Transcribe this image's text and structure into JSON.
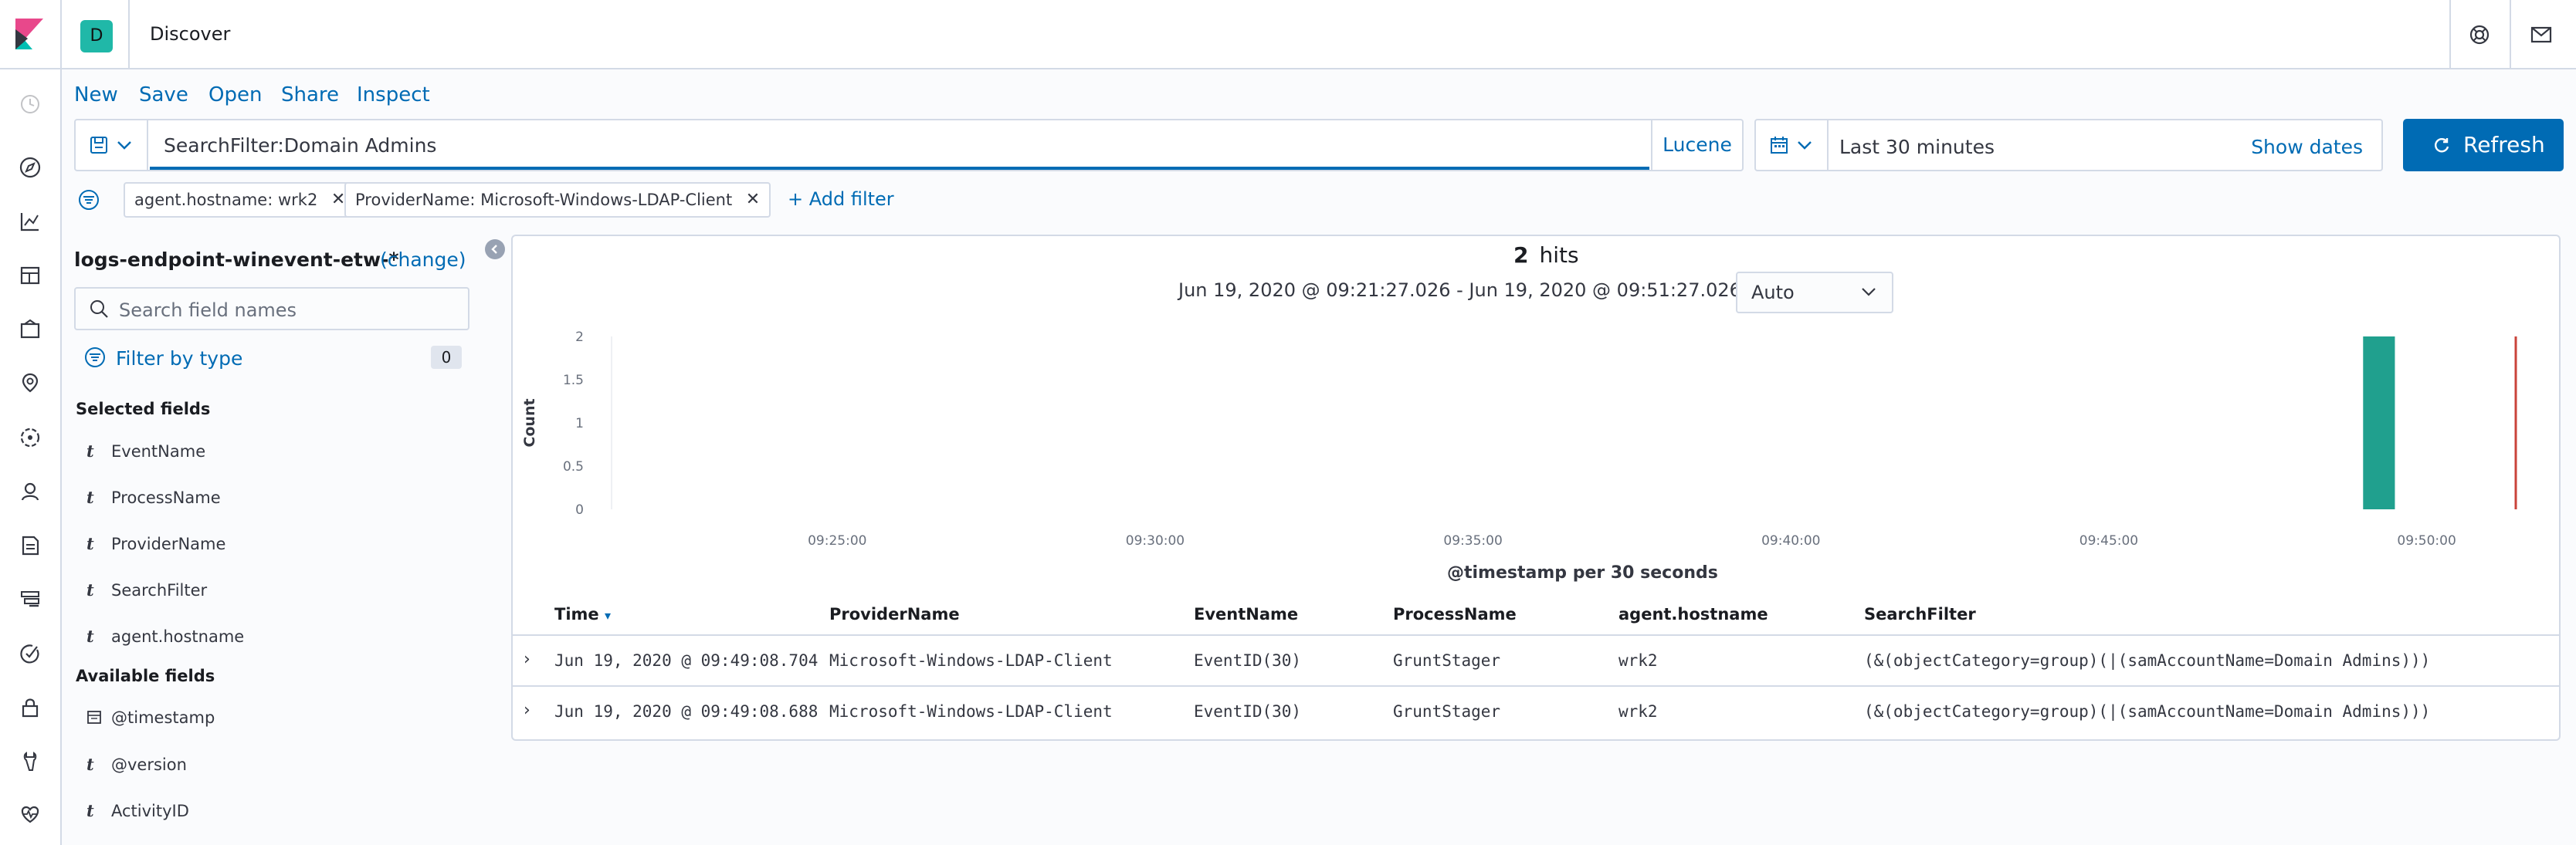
{
  "header": {
    "space_initial": "D",
    "app_title": "Discover"
  },
  "top_menu": [
    "New",
    "Save",
    "Open",
    "Share",
    "Inspect"
  ],
  "query": {
    "value": "SearchFilter:Domain Admins",
    "language": "Lucene"
  },
  "time": {
    "range_label": "Last 30 minutes",
    "show_dates": "Show dates",
    "refresh_label": "Refresh"
  },
  "filters": {
    "pills": [
      "agent.hostname: wrk2",
      "ProviderName: Microsoft-Windows-LDAP-Client"
    ],
    "add_label": "+ Add filter"
  },
  "sidebar": {
    "index_pattern": "logs-endpoint-winevent-etw-*",
    "change_label": "(change)",
    "search_placeholder": "Search field names",
    "filter_by_type": "Filter by type",
    "filter_count": "0",
    "selected_heading": "Selected fields",
    "selected_fields": [
      "EventName",
      "ProcessName",
      "ProviderName",
      "SearchFilter",
      "agent.hostname"
    ],
    "available_heading": "Available fields",
    "available_fields": [
      {
        "type": "date",
        "name": "@timestamp"
      },
      {
        "type": "t",
        "name": "@version"
      },
      {
        "type": "t",
        "name": "ActivityID"
      }
    ]
  },
  "results": {
    "hits_count": "2",
    "hits_label": "hits",
    "range_text": "Jun 19, 2020 @ 09:21:27.026 - Jun 19, 2020 @ 09:51:27.026 —",
    "interval": "Auto"
  },
  "chart_data": {
    "type": "bar",
    "xlabel": "@timestamp per 30 seconds",
    "ylabel": "Count",
    "ylim": [
      0,
      2
    ],
    "yticks": [
      "0",
      "0.5",
      "1",
      "1.5",
      "2"
    ],
    "xticks": [
      "09:25:00",
      "09:30:00",
      "09:35:00",
      "09:40:00",
      "09:45:00",
      "09:50:00"
    ],
    "x_range_minutes": [
      "09:21:27",
      "09:51:27"
    ],
    "bars": [
      {
        "x": "09:49:00",
        "value": 2
      }
    ],
    "now_marker": "09:51:27",
    "bar_color": "#20a08e",
    "now_color": "#c9433a",
    "grid": false
  },
  "table": {
    "columns": [
      "Time",
      "ProviderName",
      "EventName",
      "ProcessName",
      "agent.hostname",
      "SearchFilter"
    ],
    "rows": [
      [
        "Jun 19, 2020 @ 09:49:08.704",
        "Microsoft-Windows-LDAP-Client",
        "EventID(30)",
        "GruntStager",
        "wrk2",
        "(&(objectCategory=group)(|(samAccountName=Domain Admins)))"
      ],
      [
        "Jun 19, 2020 @ 09:49:08.688",
        "Microsoft-Windows-LDAP-Client",
        "EventID(30)",
        "GruntStager",
        "wrk2",
        "(&(objectCategory=group)(|(samAccountName=Domain Admins)))"
      ]
    ]
  },
  "colors": {
    "accent": "#006bb4",
    "border": "#d3dae6"
  }
}
